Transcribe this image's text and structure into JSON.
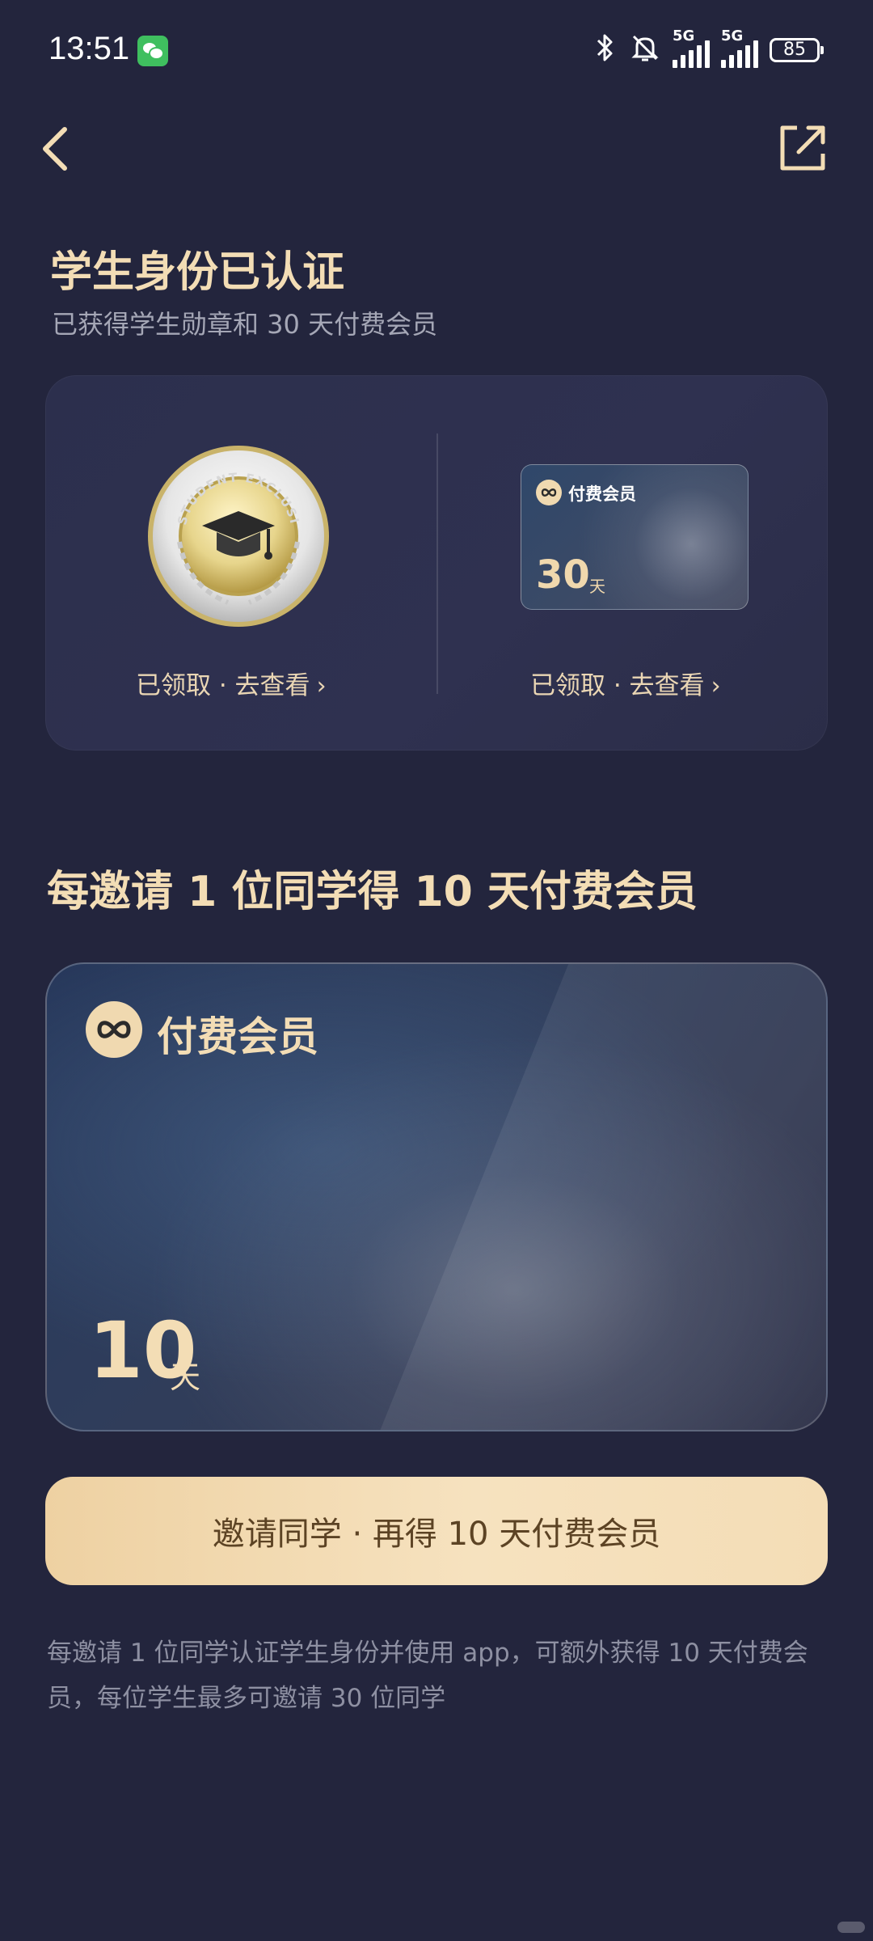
{
  "status_bar": {
    "time": "13:51",
    "network_1": "5G",
    "network_2": "5G",
    "battery": "85"
  },
  "header": {
    "title": "学生身份已认证",
    "subtitle": "已获得学生勋章和 30 天付费会员"
  },
  "rewards": {
    "medal": {
      "badge_text": "STUDENT EXCLUSIVE",
      "link_text": "已领取 · 去查看"
    },
    "membership": {
      "card_name": "付费会员",
      "days": "30",
      "unit": "天",
      "link_text": "已领取 · 去查看"
    }
  },
  "invite": {
    "heading": "每邀请 1 位同学得 10 天付费会员",
    "card": {
      "name": "付费会员",
      "days": "10",
      "unit": "天"
    },
    "button_label": "邀请同学 · 再得 10 天付费会员",
    "footnote": "每邀请 1 位同学认证学生身份并使用 app，可额外获得 10 天付费会员，每位学生最多可邀请 30 位同学"
  },
  "colors": {
    "background": "#23253d",
    "gold_text": "#f3ddb5",
    "button_fill": "#f4ddb6",
    "button_text": "#5c4324",
    "muted_text": "#8e90a2"
  },
  "icons": {
    "back": "chevron-left-icon",
    "share": "share-icon",
    "logo": "infinity-logo-icon",
    "medal": "graduation-cap-icon"
  }
}
